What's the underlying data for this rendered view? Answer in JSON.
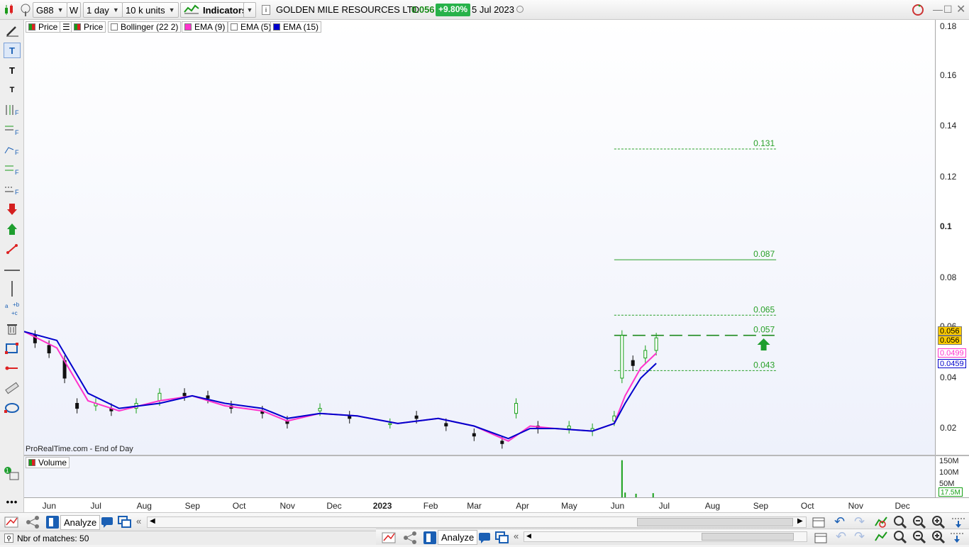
{
  "toolbar": {
    "ticker": "G88",
    "period_btn": "W",
    "timeframe": "1 day",
    "units": "10 k units",
    "indicators": "Indicators",
    "company": "GOLDEN MILE RESOURCES LTD",
    "last_price": "0.056",
    "change": "+9.80%",
    "date": "5 Jul 2023"
  },
  "legend": {
    "price1": "Price",
    "price2": "Price",
    "bollinger": "Bollinger (22 2)",
    "ema9": "EMA (9)",
    "ema5": "EMA (5)",
    "ema15": "EMA (15)"
  },
  "volume_label": "Volume",
  "source_note": "ProRealTime.com - End of Day",
  "price_axis": {
    "ticks": [
      "0.18",
      "0.16",
      "0.14",
      "0.12",
      "0.1",
      "0.08",
      "0.06",
      "0.04",
      "0.02"
    ],
    "tags": {
      "last": "0.056",
      "close": "0.056",
      "ema9": "0.0499",
      "ema15": "0.0459"
    }
  },
  "volume_axis": {
    "ticks": [
      "150M",
      "100M",
      "50M"
    ],
    "tag": "17.5M"
  },
  "time_axis": [
    "Jun",
    "Jul",
    "Aug",
    "Sep",
    "Oct",
    "Nov",
    "Dec",
    "2023",
    "Feb",
    "Mar",
    "Apr",
    "May",
    "Jun",
    "Jul",
    "Aug",
    "Sep",
    "Oct",
    "Nov",
    "Dec"
  ],
  "fib_levels": [
    "0.131",
    "0.087",
    "0.065",
    "0.057",
    "0.043"
  ],
  "colors": {
    "ema9": "#ff33cc",
    "ema15": "#0000cc",
    "up": "#18a018",
    "down": "#111111",
    "fib": "#28a028",
    "tag_yellow": "#ffcc00"
  },
  "chart_data": {
    "type": "line",
    "title": "GOLDEN MILE RESOURCES LTD",
    "xlabel": "",
    "ylabel": "",
    "ylim": [
      0.01,
      0.185
    ],
    "x_range": [
      "2022-05-25",
      "2023-12-31"
    ],
    "series": [
      {
        "name": "EMA (9)",
        "x": [
          "2022-05-25",
          "2022-06-15",
          "2022-07-05",
          "2022-07-25",
          "2022-08-20",
          "2022-09-10",
          "2022-10-01",
          "2022-10-25",
          "2022-11-10",
          "2022-12-01",
          "2022-12-25",
          "2023-01-20",
          "2023-02-15",
          "2023-03-10",
          "2023-04-01",
          "2023-04-15",
          "2023-05-01",
          "2023-05-25",
          "2023-06-08",
          "2023-06-15",
          "2023-06-25",
          "2023-07-05"
        ],
        "values": [
          0.0585,
          0.052,
          0.031,
          0.027,
          0.031,
          0.033,
          0.029,
          0.027,
          0.023,
          0.026,
          0.025,
          0.022,
          0.024,
          0.021,
          0.015,
          0.021,
          0.02,
          0.019,
          0.022,
          0.033,
          0.044,
          0.0499
        ]
      },
      {
        "name": "EMA (15)",
        "x": [
          "2022-05-25",
          "2022-06-15",
          "2022-07-05",
          "2022-07-25",
          "2022-08-20",
          "2022-09-10",
          "2022-10-01",
          "2022-10-25",
          "2022-11-10",
          "2022-12-01",
          "2022-12-25",
          "2023-01-20",
          "2023-02-15",
          "2023-03-10",
          "2023-04-01",
          "2023-04-15",
          "2023-05-01",
          "2023-05-25",
          "2023-06-08",
          "2023-06-15",
          "2023-06-25",
          "2023-07-05"
        ],
        "values": [
          0.0585,
          0.055,
          0.034,
          0.028,
          0.03,
          0.033,
          0.03,
          0.028,
          0.024,
          0.026,
          0.025,
          0.022,
          0.024,
          0.021,
          0.016,
          0.02,
          0.02,
          0.019,
          0.022,
          0.03,
          0.04,
          0.0459
        ]
      }
    ],
    "bars": [
      {
        "x": "2022-06-01",
        "o": 0.057,
        "c": 0.054
      },
      {
        "x": "2022-06-10",
        "o": 0.053,
        "c": 0.05
      },
      {
        "x": "2022-06-20",
        "o": 0.047,
        "c": 0.04
      },
      {
        "x": "2022-06-28",
        "o": 0.03,
        "c": 0.028
      },
      {
        "x": "2022-07-10",
        "o": 0.029,
        "c": 0.03
      },
      {
        "x": "2022-07-20",
        "o": 0.028,
        "c": 0.027
      },
      {
        "x": "2022-08-05",
        "o": 0.028,
        "c": 0.03
      },
      {
        "x": "2022-08-20",
        "o": 0.031,
        "c": 0.034
      },
      {
        "x": "2022-09-05",
        "o": 0.034,
        "c": 0.033
      },
      {
        "x": "2022-09-20",
        "o": 0.033,
        "c": 0.032
      },
      {
        "x": "2022-10-05",
        "o": 0.029,
        "c": 0.028
      },
      {
        "x": "2022-10-25",
        "o": 0.027,
        "c": 0.026
      },
      {
        "x": "2022-11-10",
        "o": 0.023,
        "c": 0.022
      },
      {
        "x": "2022-12-01",
        "o": 0.027,
        "c": 0.028
      },
      {
        "x": "2022-12-20",
        "o": 0.025,
        "c": 0.024
      },
      {
        "x": "2023-01-15",
        "o": 0.022,
        "c": 0.022
      },
      {
        "x": "2023-02-01",
        "o": 0.025,
        "c": 0.024
      },
      {
        "x": "2023-02-20",
        "o": 0.022,
        "c": 0.021
      },
      {
        "x": "2023-03-10",
        "o": 0.018,
        "c": 0.017
      },
      {
        "x": "2023-03-28",
        "o": 0.015,
        "c": 0.014
      },
      {
        "x": "2023-04-06",
        "o": 0.026,
        "c": 0.03
      },
      {
        "x": "2023-04-20",
        "o": 0.021,
        "c": 0.02
      },
      {
        "x": "2023-05-10",
        "o": 0.02,
        "c": 0.021
      },
      {
        "x": "2023-05-25",
        "o": 0.019,
        "c": 0.02
      },
      {
        "x": "2023-06-08",
        "o": 0.023,
        "c": 0.025
      },
      {
        "x": "2023-06-13",
        "o": 0.04,
        "c": 0.057
      },
      {
        "x": "2023-06-20",
        "o": 0.047,
        "c": 0.045
      },
      {
        "x": "2023-06-28",
        "o": 0.048,
        "c": 0.051
      },
      {
        "x": "2023-07-05",
        "o": 0.051,
        "c": 0.056
      }
    ],
    "volume_bars": [
      {
        "x": "2023-06-13",
        "v": 155
      },
      {
        "x": "2023-06-15",
        "v": 20
      },
      {
        "x": "2023-06-22",
        "v": 15
      },
      {
        "x": "2023-07-03",
        "v": 17.5
      }
    ]
  }
}
